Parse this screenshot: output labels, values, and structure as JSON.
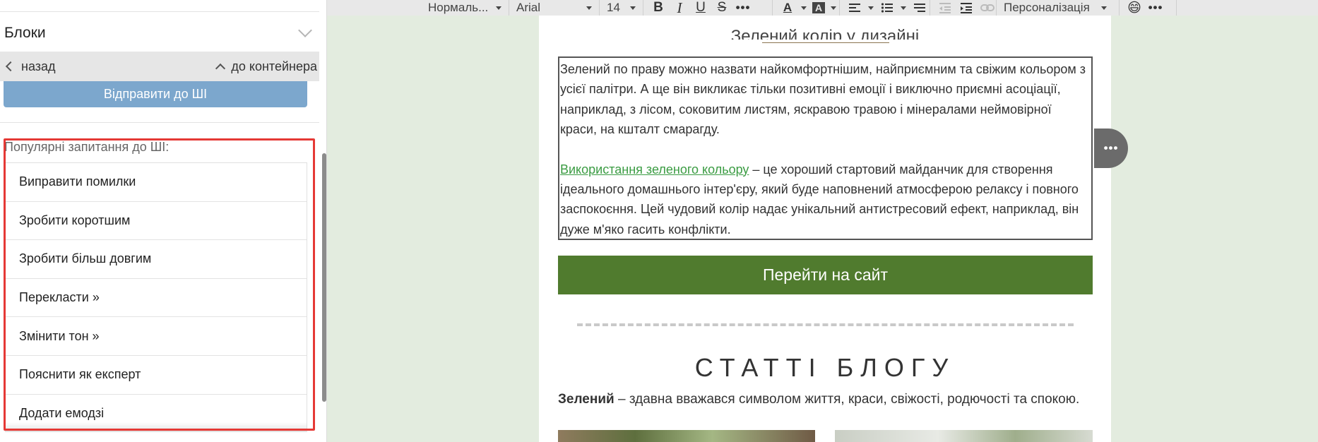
{
  "sidebar": {
    "blocks_title": "Блоки",
    "nav": {
      "back": "назад",
      "to_container": "до контейнера"
    },
    "ai_send_button": "Відправити до ШІ",
    "popular_label": "Популярні запитання до ШІ:",
    "questions": [
      "Виправити помилки",
      "Зробити коротшим",
      "Зробити більш довгим",
      "Перекласти »",
      "Змінити тон »",
      "Пояснити як експерт",
      "Додати емодзі"
    ]
  },
  "toolbar": {
    "style_select": "Нормаль...",
    "font_select": "Arial",
    "size_select": "14",
    "bold": "B",
    "italic": "I",
    "underline": "U",
    "strike": "S",
    "more": "•••",
    "text_color": "A",
    "bg_color": "A",
    "personalization": "Персоналізація",
    "emoji": "😄",
    "more_end": "•••"
  },
  "email": {
    "cut_heading": "Зелений колір у дизайні",
    "paragraph1": "Зелений по праву можно назвати найкомфортнішим, найприємним та свіжим кольором з усієї палітри. А ще він викликає тільки позитивні емоції і виключно приємні асоціації, наприклад, з лісом, соковитим листям, яскравою травою і мінералами неймовірної краси, на кшталт смарагду.",
    "link_text": "Використання зеленого кольору",
    "paragraph2_rest": " – це хороший стартовий майданчик для створення ідеального домашнього інтер'єру, який буде наповнений атмосферою релаксу і повного заспокоєння. Цей чудовий колір надає унікальний антистресовий ефект, наприклад, він дуже м'яко гасить конфлікти.",
    "site_button": "Перейти на сайт",
    "blog_title": "СТАТТІ БЛОГУ",
    "blog_desc_bold": "Зелений",
    "blog_desc_rest": " – здавна вважався символом життя, краси, свіжості, родючості та спокою.",
    "side_more": "•••"
  },
  "colors": {
    "accent_button": "#507b2e",
    "ai_button": "#7ca7cd",
    "link": "#3b9c43",
    "highlight": "#e53935",
    "canvas_bg": "#e3ecdf"
  },
  "icons": [
    "chevron-down-icon",
    "chevron-left-icon",
    "chevron-up-icon",
    "align-icon",
    "list-icon",
    "line-height-icon",
    "outdent-icon",
    "indent-icon",
    "link-icon",
    "emoji-icon",
    "more-icon"
  ]
}
